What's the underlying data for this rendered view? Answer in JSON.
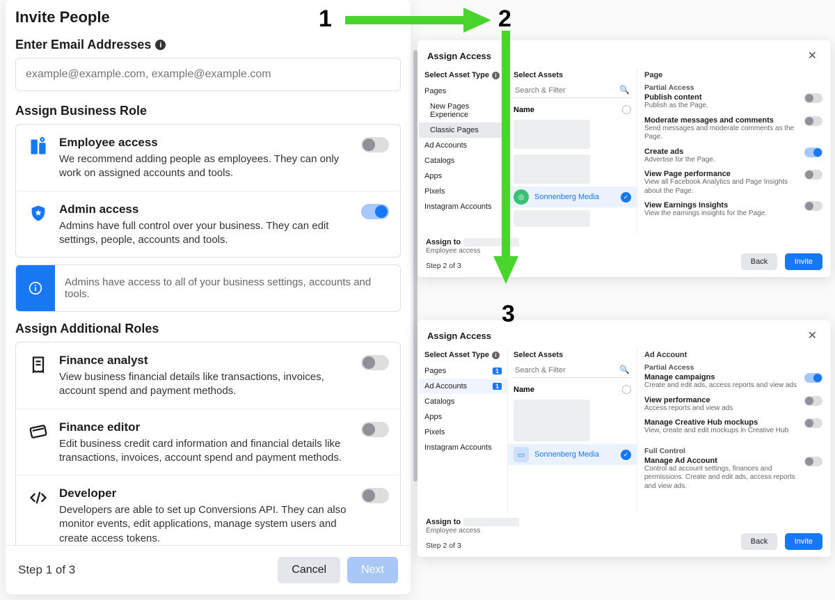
{
  "annotations": {
    "n1": "1",
    "n2": "2",
    "n3": "3"
  },
  "left": {
    "title": "Invite People",
    "emailHeading": "Enter Email Addresses",
    "emailPlaceholder": "example@example.com, example@example.com",
    "roleHeading": "Assign Business Role",
    "roles": {
      "employee": {
        "name": "Employee access",
        "desc": "We recommend adding people as employees. They can only work on assigned accounts and tools."
      },
      "admin": {
        "name": "Admin access",
        "desc": "Admins have full control over your business. They can edit settings, people, accounts and tools."
      }
    },
    "infoMessage": "Admins have access to all of your business settings, accounts and tools.",
    "additionalHeading": "Assign Additional Roles",
    "addRoles": {
      "finAnalyst": {
        "name": "Finance analyst",
        "desc": "View business financial details like transactions, invoices, account spend and payment methods."
      },
      "finEditor": {
        "name": "Finance editor",
        "desc": "Edit business credit card information and financial details like transactions, invoices, account spend and payment methods."
      },
      "developer": {
        "name": "Developer",
        "desc": "Developers are able to set up Conversions API. They can also monitor events, edit applications, manage system users and create access tokens."
      }
    },
    "step": "Step 1 of 3",
    "cancel": "Cancel",
    "next": "Next"
  },
  "panel2": {
    "title": "Assign Access",
    "assetTypeHeading": "Select Asset Type",
    "tree": {
      "pages": "Pages",
      "newPages": "New Pages Experience",
      "classicPages": "Classic Pages",
      "adAccounts": "Ad Accounts",
      "catalogs": "Catalogs",
      "apps": "Apps",
      "pixels": "Pixels",
      "instagram": "Instagram Accounts"
    },
    "selectAssets": "Select Assets",
    "searchPlaceholder": "Search & Filter",
    "nameHeader": "Name",
    "selectedAsset": "Sonnenberg Media",
    "permHeading": "Page",
    "partial": "Partial Access",
    "perms": [
      {
        "t": "Publish content",
        "d": "Publish as the Page.",
        "on": false
      },
      {
        "t": "Moderate messages and comments",
        "d": "Send messages and moderate comments as the Page.",
        "on": false
      },
      {
        "t": "Create ads",
        "d": "Advertise for the Page.",
        "on": true
      },
      {
        "t": "View Page performance",
        "d": "View all Facebook Analytics and Page Insights about the Page.",
        "on": false
      },
      {
        "t": "View Earnings Insights",
        "d": "View the earnings insights for the Page.",
        "on": false
      }
    ],
    "assignTo": "Assign to",
    "assignRole": "Employee access",
    "step": "Step 2 of 3",
    "back": "Back",
    "invite": "Invite"
  },
  "panel3": {
    "title": "Assign Access",
    "assetTypeHeading": "Select Asset Type",
    "tree": {
      "pages": "Pages",
      "adAccounts": "Ad Accounts",
      "catalogs": "Catalogs",
      "apps": "Apps",
      "pixels": "Pixels",
      "instagram": "Instagram Accounts"
    },
    "badge": "1",
    "selectAssets": "Select Assets",
    "searchPlaceholder": "Search & Filter",
    "nameHeader": "Name",
    "selectedAsset": "Sonnenberg Media",
    "permHeading": "Ad Account",
    "partial": "Partial Access",
    "perms": [
      {
        "t": "Manage campaigns",
        "d": "Create and edit ads, access reports and view ads",
        "on": true
      },
      {
        "t": "View performance",
        "d": "Access reports and view ads",
        "on": false
      },
      {
        "t": "Manage Creative Hub mockups",
        "d": "View, create and edit mockups in Creative Hub",
        "on": false
      }
    ],
    "full": "Full Control",
    "fullPerm": {
      "t": "Manage Ad Account",
      "d": "Control ad account settings, finances and permissions. Create and edit ads, access reports and view ads.",
      "on": false
    },
    "assignTo": "Assign to",
    "assignRole": "Employee access",
    "step": "Step 2 of 3",
    "back": "Back",
    "invite": "Invite"
  }
}
